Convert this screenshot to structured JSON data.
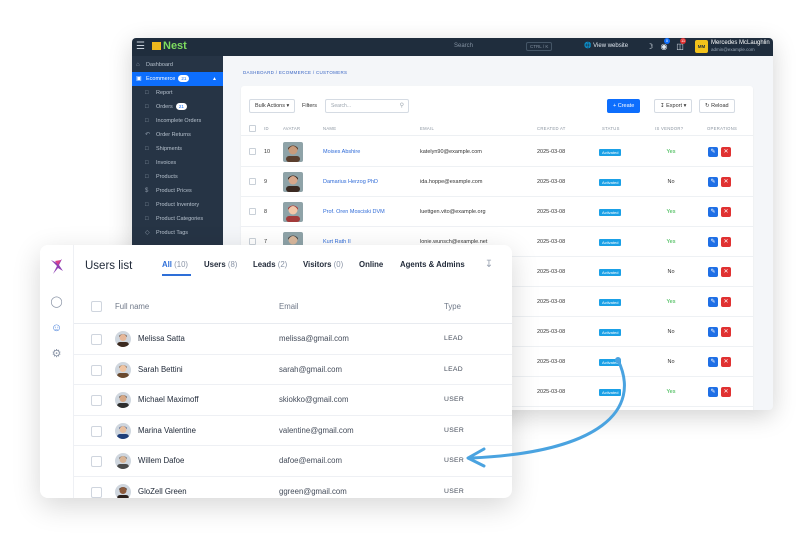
{
  "admin": {
    "topbar": {
      "logo": "Nest",
      "search_placeholder": "Search",
      "search_shortcut": "CTRL / K",
      "view_website": "View website",
      "notif_count": "0",
      "cart_count": "11",
      "user_initials": "MM",
      "user_name": "Mercedes McLaughlin",
      "user_email": "admin@example.com"
    },
    "sidebar": {
      "items": [
        {
          "label": "Dashboard"
        },
        {
          "label": "Ecommerce",
          "count": "21"
        },
        {
          "label": "Report"
        },
        {
          "label": "Orders",
          "count": "21"
        },
        {
          "label": "Incomplete Orders"
        },
        {
          "label": "Order Returns"
        },
        {
          "label": "Shipments"
        },
        {
          "label": "Invoices"
        },
        {
          "label": "Products"
        },
        {
          "label": "Product Prices"
        },
        {
          "label": "Product Inventory"
        },
        {
          "label": "Product Categories"
        },
        {
          "label": "Product Tags"
        }
      ]
    },
    "breadcrumb": "DASHBOARD  /  ECOMMERCE  /  CUSTOMERS",
    "toolbar": {
      "bulk_actions": "Bulk Actions",
      "filters": "Filters",
      "search_placeholder": "Search...",
      "create": "Create",
      "export": "Export",
      "reload": "Reload"
    },
    "columns": [
      "ID",
      "AVATAR",
      "NAME",
      "EMAIL",
      "CREATED AT",
      "STATUS",
      "IS VENDOR?",
      "OPERATIONS"
    ],
    "rows": [
      {
        "id": "10",
        "name": "Moises Abshire",
        "email": "katelyn90@example.com",
        "created": "2025-03-08",
        "status": "Activated",
        "vendor": "Yes"
      },
      {
        "id": "9",
        "name": "Damarius Herzog PhD",
        "email": "ida.hoppe@example.com",
        "created": "2025-03-08",
        "status": "Activated",
        "vendor": "No"
      },
      {
        "id": "8",
        "name": "Prof. Oren Mosciski DVM",
        "email": "luettgen.vito@example.org",
        "created": "2025-03-08",
        "status": "Activated",
        "vendor": "Yes"
      },
      {
        "id": "7",
        "name": "Kurt Rath II",
        "email": "lonie.wunsch@example.net",
        "created": "2025-03-08",
        "status": "Activated",
        "vendor": "Yes"
      },
      {
        "id": "",
        "name": "",
        "email": "",
        "created": "2025-03-08",
        "status": "Activated",
        "vendor": "No"
      },
      {
        "id": "",
        "name": "",
        "email": "",
        "created": "2025-03-08",
        "status": "Activated",
        "vendor": "Yes"
      },
      {
        "id": "",
        "name": "",
        "email": "",
        "created": "2025-03-08",
        "status": "Activated",
        "vendor": "No"
      },
      {
        "id": "",
        "name": "",
        "email": "",
        "created": "2025-03-08",
        "status": "Activated",
        "vendor": "No"
      },
      {
        "id": "",
        "name": "",
        "email": "",
        "created": "2025-03-08",
        "status": "Activated",
        "vendor": "Yes"
      }
    ]
  },
  "users": {
    "title": "Users list",
    "tabs": [
      {
        "label": "All",
        "count": "(10)"
      },
      {
        "label": "Users",
        "count": "(8)"
      },
      {
        "label": "Leads",
        "count": "(2)"
      },
      {
        "label": "Visitors",
        "count": "(0)"
      },
      {
        "label": "Online",
        "count": ""
      },
      {
        "label": "Agents & Admins",
        "count": ""
      }
    ],
    "columns": {
      "full_name": "Full name",
      "email": "Email",
      "type": "Type"
    },
    "rows": [
      {
        "name": "Melissa Satta",
        "email": "melissa@gmail.com",
        "type": "LEAD"
      },
      {
        "name": "Sarah Bettini",
        "email": "sarah@gmail.com",
        "type": "LEAD"
      },
      {
        "name": "Michael Maximoff",
        "email": "skiokko@gmail.com",
        "type": "USER"
      },
      {
        "name": "Marina Valentine",
        "email": "valentine@gmail.com",
        "type": "USER"
      },
      {
        "name": "Willem Dafoe",
        "email": "dafoe@email.com",
        "type": "USER"
      },
      {
        "name": "GloZell Green",
        "email": "ggreen@gmail.com",
        "type": "USER"
      }
    ]
  },
  "colors": {
    "primary": "#0d6efd",
    "admin_sidebar": "#263445",
    "admin_topbar": "#1f2d3d",
    "status_badge": "#1aa0e6",
    "vendor_yes": "#2fb344",
    "delete": "#e03131",
    "arrow": "#4aa3e0",
    "tab_active": "#2e6fd8"
  }
}
